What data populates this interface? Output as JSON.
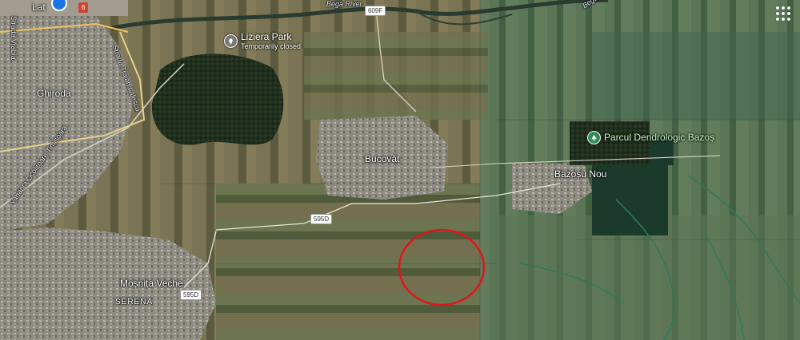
{
  "map": {
    "type": "satellite",
    "highlight_color": "#e0141e",
    "places": {
      "ghiroda": "Ghiroda",
      "bucovat": "Bucovăț",
      "bazosu_nou": "Bazoșu Nou",
      "mosnita_veche": "Moșnița Veche",
      "serena": "SERENA",
      "top_left_partial": "Lat"
    },
    "pois": {
      "liziera": {
        "name": "Liziera Park",
        "status": "Temporarily closed",
        "icon": "place-pin-icon"
      },
      "dendro": {
        "name": "Parcul Dendrologic Bazoș",
        "icon": "park-icon"
      }
    },
    "rivers": {
      "bega_upper": "Bega River",
      "bega_lower": "Bega River"
    },
    "streets": {
      "vrabia": "Strada Vrabia",
      "traian": "Strada Traian Lalescu",
      "ocolitoare": "Varianta Ocolitoare Timișoara"
    },
    "roads": {
      "r609f": "609F",
      "r595d_a": "595D",
      "r595d_b": "595D",
      "r6": "6"
    },
    "apps_icon": "apps-grid-icon"
  }
}
